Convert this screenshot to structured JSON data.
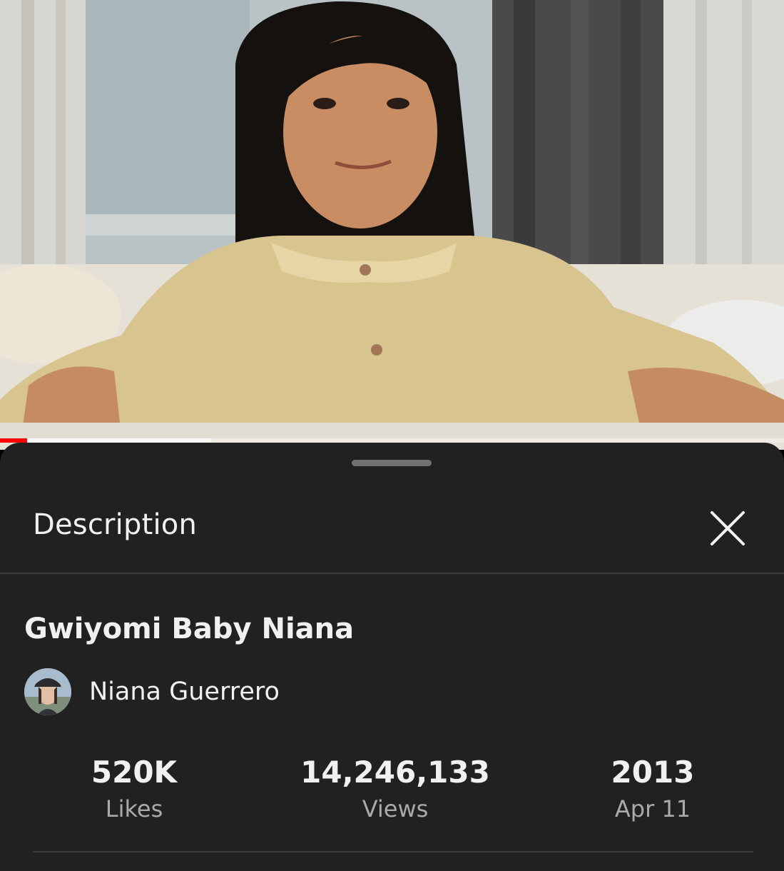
{
  "player": {
    "progress_played_fraction": 0.035
  },
  "sheet": {
    "title": "Description",
    "close_icon": "close-icon"
  },
  "video": {
    "title": "Gwiyomi Baby Niana",
    "channel": "Niana Guerrero"
  },
  "stats": {
    "likes_value": "520K",
    "likes_label": "Likes",
    "views_value": "14,246,133",
    "views_label": "Views",
    "year_value": "2013",
    "date_label": "Apr 11"
  },
  "colors": {
    "sheet_bg": "#212121",
    "progress_red": "#ff0000",
    "text_primary": "#f1f1f1",
    "text_secondary": "#aaaaaa"
  }
}
